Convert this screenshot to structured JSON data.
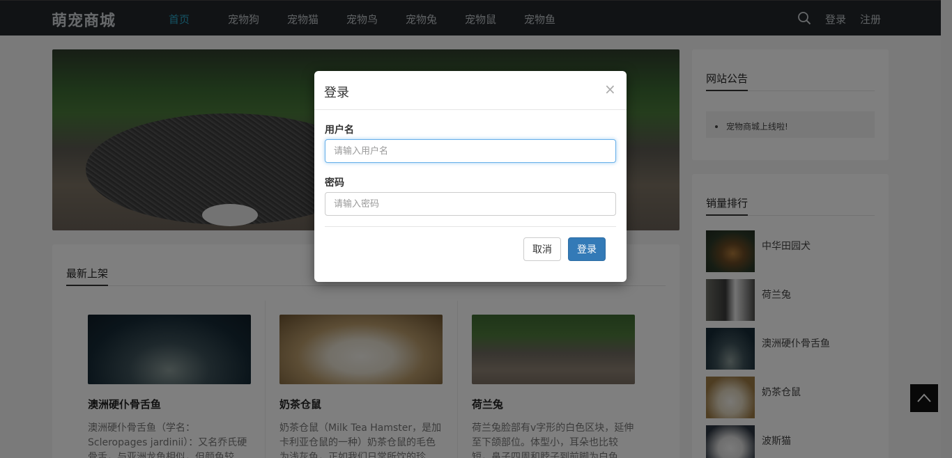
{
  "header": {
    "brand": "萌宠商城",
    "menu": [
      {
        "label": "首页",
        "active": true
      },
      {
        "label": "宠物狗"
      },
      {
        "label": "宠物猫"
      },
      {
        "label": "宠物鸟"
      },
      {
        "label": "宠物兔"
      },
      {
        "label": "宠物鼠"
      },
      {
        "label": "宠物鱼"
      }
    ],
    "login": "登录",
    "register": "注册"
  },
  "main": {
    "latest_title": "最新上架",
    "products": [
      {
        "name": "澳洲硬仆骨舌鱼",
        "desc": "澳洲硬仆骨舌鱼（学名：Scleropages jardinii）：又名乔氏硬骨舌，与亚洲龙鱼相似，但颜色较"
      },
      {
        "name": "奶茶仓鼠",
        "desc": "奶茶仓鼠（Milk Tea Hamster，是加卡利亚仓鼠的一种）奶茶仓鼠的毛色为浅灰色，正如我们日常所饮的珍"
      },
      {
        "name": "荷兰兔",
        "desc": "荷兰兔脸部有v字形的白色区块，延伸至下颌部位。体型小，耳朵也比较短，鼻子四周和脖子到前脚为白色"
      }
    ]
  },
  "sidebar": {
    "notice_title": "网站公告",
    "notices": [
      "宠物商城上线啦!"
    ],
    "rank_title": "销量排行",
    "rank_items": [
      "中华田园犬",
      "荷兰兔",
      "澳洲硬仆骨舌鱼",
      "奶茶仓鼠",
      "波斯猫"
    ]
  },
  "modal": {
    "title": "登录",
    "close": "×",
    "username_label": "用户名",
    "username_placeholder": "请输入用户名",
    "password_label": "密码",
    "password_placeholder": "请输入密码",
    "cancel": "取消",
    "submit": "登录"
  },
  "colors": {
    "nav_bg": "#22272b",
    "active_menu": "#2aa7c9",
    "primary_button": "#337ab7"
  }
}
